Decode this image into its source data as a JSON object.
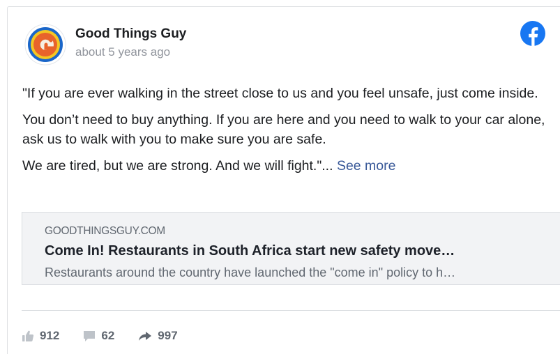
{
  "post": {
    "author": "Good Things Guy",
    "timestamp": "about 5 years ago",
    "paragraphs": [
      "\"If you are ever walking in the street close to us and you feel unsafe, just come inside.",
      "You don’t need to buy anything. If you are here and you need to walk to your car alone, ask us to walk with you to make sure you are safe.",
      " We are tired, but we are strong. And we will fight.\"... "
    ],
    "see_more": "See more"
  },
  "link_preview": {
    "domain": "GOODTHINGSGUY.COM",
    "title": "Come In! Restaurants in South Africa start new safety move…",
    "description": "Restaurants around the country have launched the \"come in\" policy to h…"
  },
  "stats": {
    "likes": "912",
    "comments": "62",
    "shares": "997"
  },
  "icons": {
    "platform": "facebook-icon",
    "like": "thumbs-up-icon",
    "comment": "comment-bubble-icon",
    "share": "share-arrow-icon"
  },
  "colors": {
    "facebook_blue": "#1877f2",
    "link_blue": "#385898",
    "muted": "#90949c"
  }
}
